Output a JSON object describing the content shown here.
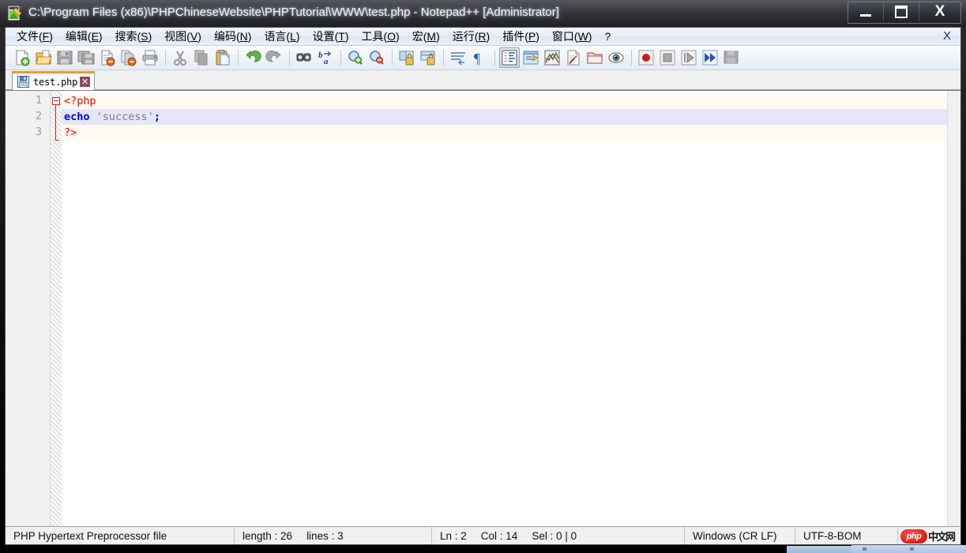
{
  "window": {
    "title": "C:\\Program Files (x86)\\PHPChineseWebsite\\PHPTutorial\\WWW\\test.php - Notepad++ [Administrator]",
    "icon": "notepad-plus-plus-icon",
    "buttons": {
      "minimize": "minimize-button",
      "maximize": "maximize-button",
      "close_label": "X"
    }
  },
  "menubar": {
    "items": [
      {
        "label": "文件(F)",
        "text": "文件(",
        "key": "F",
        "tail": ")"
      },
      {
        "label": "编辑(E)",
        "text": "编辑(",
        "key": "E",
        "tail": ")"
      },
      {
        "label": "搜索(S)",
        "text": "搜索(",
        "key": "S",
        "tail": ")"
      },
      {
        "label": "视图(V)",
        "text": "视图(",
        "key": "V",
        "tail": ")"
      },
      {
        "label": "编码(N)",
        "text": "编码(",
        "key": "N",
        "tail": ")"
      },
      {
        "label": "语言(L)",
        "text": "语言(",
        "key": "L",
        "tail": ")"
      },
      {
        "label": "设置(T)",
        "text": "设置(",
        "key": "T",
        "tail": ")"
      },
      {
        "label": "工具(O)",
        "text": "工具(",
        "key": "O",
        "tail": ")"
      },
      {
        "label": "宏(M)",
        "text": "宏(",
        "key": "M",
        "tail": ")"
      },
      {
        "label": "运行(R)",
        "text": "运行(",
        "key": "R",
        "tail": ")"
      },
      {
        "label": "插件(P)",
        "text": "插件(",
        "key": "P",
        "tail": ")"
      },
      {
        "label": "窗口(W)",
        "text": "窗口(",
        "key": "W",
        "tail": ")"
      },
      {
        "label": "?",
        "text": "?",
        "key": "",
        "tail": ""
      }
    ],
    "close_doc_label": "X"
  },
  "toolbar": {
    "groups": [
      [
        "new-file-icon",
        "open-file-icon",
        "save-icon",
        "save-all-icon",
        "close-file-icon",
        "close-all-files-icon",
        "print-icon"
      ],
      [
        "cut-icon",
        "copy-icon",
        "paste-icon"
      ],
      [
        "undo-icon",
        "redo-icon"
      ],
      [
        "find-icon",
        "replace-icon"
      ],
      [
        "zoom-in-icon",
        "zoom-out-icon"
      ],
      [
        "sync-vertical-scroll-icon",
        "sync-horizontal-scroll-icon"
      ],
      [
        "word-wrap-icon",
        "show-all-characters-icon"
      ],
      [
        "show-indent-guide-icon",
        "user-defined-language-icon",
        "show-document-map-icon",
        "function-list-icon",
        "folder-as-workspace-icon",
        "document-preview-icon"
      ],
      [
        "record-macro-icon",
        "stop-recording-macro-icon",
        "play-macro-icon",
        "run-macro-multiple-times-icon",
        "save-macro-icon"
      ]
    ]
  },
  "tabs": [
    {
      "icon": "saved-document-icon",
      "label": "test.php",
      "close_label": "✕",
      "active": true
    }
  ],
  "editor": {
    "line_numbers": [
      "1",
      "2",
      "3"
    ],
    "fold_marker": "collapse-marker",
    "lines": [
      {
        "number": "1",
        "highlight": "php-block",
        "tokens": [
          {
            "type": "phptag",
            "text": "<?php"
          }
        ]
      },
      {
        "number": "2",
        "highlight": "current-line",
        "tokens": [
          {
            "type": "kw",
            "text": "echo"
          },
          {
            "type": "plain",
            "text": " "
          },
          {
            "type": "str",
            "text": "'success'"
          },
          {
            "type": "op",
            "text": ";"
          }
        ]
      },
      {
        "number": "3",
        "highlight": "php-block",
        "tokens": [
          {
            "type": "phptag",
            "text": "?>"
          }
        ]
      }
    ]
  },
  "statusbar": {
    "file_type": "PHP Hypertext Preprocessor file",
    "length_label": "length : 26",
    "lines_label": "lines : 3",
    "ln_label": "Ln : 2",
    "col_label": "Col : 14",
    "sel_label": "Sel : 0 | 0",
    "eol": "Windows (CR LF)",
    "encoding": "UTF-8-BOM",
    "watermark": {
      "badge": "php",
      "text": "中文网"
    }
  },
  "colors": {
    "php_tag": "#ff0000",
    "keyword": "#0000ff",
    "string": "#808080",
    "current_line_bg": "#e6e6fa",
    "php_block_bg": "#fefaef",
    "tab_accent": "#f59a23",
    "title_bar": "#1a1a1c"
  }
}
